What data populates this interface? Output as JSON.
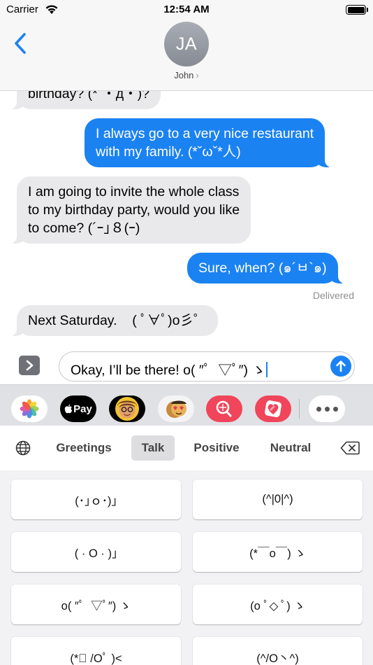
{
  "status_bar": {
    "carrier": "Carrier",
    "time": "12:54 AM"
  },
  "header": {
    "avatar_initials": "JA",
    "contact_name": "John",
    "contact_chevron": "›"
  },
  "messages": [
    {
      "from": "them",
      "text": "birthday? (*´・д・)?"
    },
    {
      "from": "me",
      "lines": [
        "I always go to a very nice restaurant",
        "with my family. (*ˇωˇ*人)"
      ]
    },
    {
      "from": "them",
      "lines": [
        "I am going to invite the whole class",
        "to my birthday party, would you like",
        "to come? (´ｰ｣８(ｰ)"
      ]
    },
    {
      "from": "me",
      "text": "Sure, when? (๑´ㅂ`๑)"
    },
    {
      "from": "them",
      "text": "Next Saturday.    ( ﾟ∀ﾟ)o彡゜"
    }
  ],
  "delivered_label": "Delivered",
  "compose": {
    "text": "Okay, I’ll be there! o( ″ﾟ  ▽ﾟ″) ゝ"
  },
  "app_drawer": {
    "apps": [
      "photos-icon",
      "apple-pay-icon",
      "memoji-icon",
      "stickers-icon",
      "image-search-icon",
      "heart-app-icon"
    ],
    "apple_pay_label": "Pay",
    "accent": "#1b82f2"
  },
  "keyboard": {
    "tabs": [
      "Greetings",
      "Talk",
      "Positive",
      "Neutral"
    ],
    "active_tab": "Talk",
    "keys": [
      "(･｣ｏ･)｣",
      "(^|0|^)",
      "( · O · )｣",
      "(*￣o￣) ゝ",
      "o( ″ﾟ  ▽ﾟ″) ゝ",
      "(o ﾟ◇ ﾟ) ゝ",
      "(*ﾟ /Oﾟ )<",
      "(^/O丶^)"
    ]
  }
}
